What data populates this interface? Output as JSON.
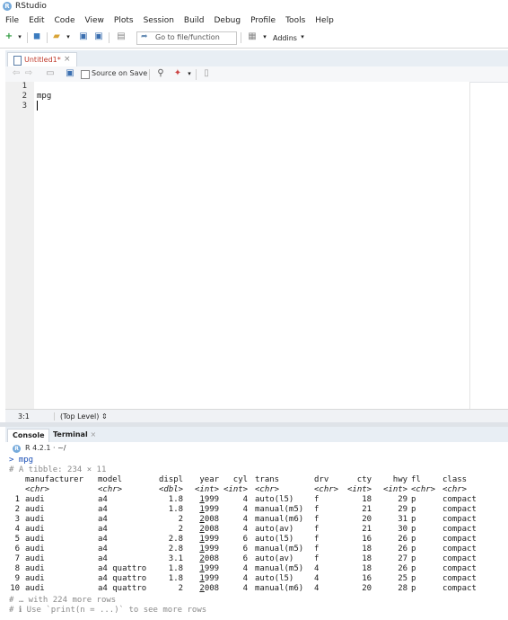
{
  "app": {
    "title": "RStudio",
    "logo_letter": "R"
  },
  "menu": [
    "File",
    "Edit",
    "Code",
    "View",
    "Plots",
    "Session",
    "Build",
    "Debug",
    "Profile",
    "Tools",
    "Help"
  ],
  "toolbar": {
    "goto_placeholder": "Go to file/function",
    "addins_label": "Addins"
  },
  "editor": {
    "tab_name": "Untitled1*",
    "source_on_save_label": "Source on Save",
    "line_numbers": [
      "1",
      "2",
      "3"
    ],
    "lines": [
      "",
      "mpg",
      ""
    ],
    "cursor_position": "3:1",
    "scope_level": "(Top Level)"
  },
  "console_pane": {
    "tabs": [
      "Console",
      "Terminal"
    ],
    "r_version": "R 4.2.1 · ~/",
    "prompt": "> mpg",
    "tibble_header": "# A tibble: 234 × 11",
    "columns": [
      "manufacturer",
      "model",
      "displ",
      "year",
      "cyl",
      "trans",
      "drv",
      "cty",
      "hwy",
      "fl",
      "class"
    ],
    "column_types": [
      "<chr>",
      "<chr>",
      "<dbl>",
      "<int>",
      "<int>",
      "<chr>",
      "<chr>",
      "<int>",
      "<int>",
      "<chr>",
      "<chr>"
    ],
    "rows": [
      [
        "1",
        "audi",
        "a4",
        "1.8",
        "1999",
        "4",
        "auto(l5)",
        "f",
        "18",
        "29",
        "p",
        "compact"
      ],
      [
        "2",
        "audi",
        "a4",
        "1.8",
        "1999",
        "4",
        "manual(m5)",
        "f",
        "21",
        "29",
        "p",
        "compact"
      ],
      [
        "3",
        "audi",
        "a4",
        "2",
        "2008",
        "4",
        "manual(m6)",
        "f",
        "20",
        "31",
        "p",
        "compact"
      ],
      [
        "4",
        "audi",
        "a4",
        "2",
        "2008",
        "4",
        "auto(av)",
        "f",
        "21",
        "30",
        "p",
        "compact"
      ],
      [
        "5",
        "audi",
        "a4",
        "2.8",
        "1999",
        "6",
        "auto(l5)",
        "f",
        "16",
        "26",
        "p",
        "compact"
      ],
      [
        "6",
        "audi",
        "a4",
        "2.8",
        "1999",
        "6",
        "manual(m5)",
        "f",
        "18",
        "26",
        "p",
        "compact"
      ],
      [
        "7",
        "audi",
        "a4",
        "3.1",
        "2008",
        "6",
        "auto(av)",
        "f",
        "18",
        "27",
        "p",
        "compact"
      ],
      [
        "8",
        "audi",
        "a4 quattro",
        "1.8",
        "1999",
        "4",
        "manual(m5)",
        "4",
        "18",
        "26",
        "p",
        "compact"
      ],
      [
        "9",
        "audi",
        "a4 quattro",
        "1.8",
        "1999",
        "4",
        "auto(l5)",
        "4",
        "16",
        "25",
        "p",
        "compact"
      ],
      [
        "10",
        "audi",
        "a4 quattro",
        "2",
        "2008",
        "4",
        "manual(m6)",
        "4",
        "20",
        "28",
        "p",
        "compact"
      ]
    ],
    "footer_more": "# … with 224 more rows",
    "footer_hint": "# ℹ Use `print(n = ...)` to see more rows"
  },
  "colors": {
    "accent": "#75aadb",
    "prompt": "#1b4fb5",
    "comment": "#8a8a8a"
  }
}
